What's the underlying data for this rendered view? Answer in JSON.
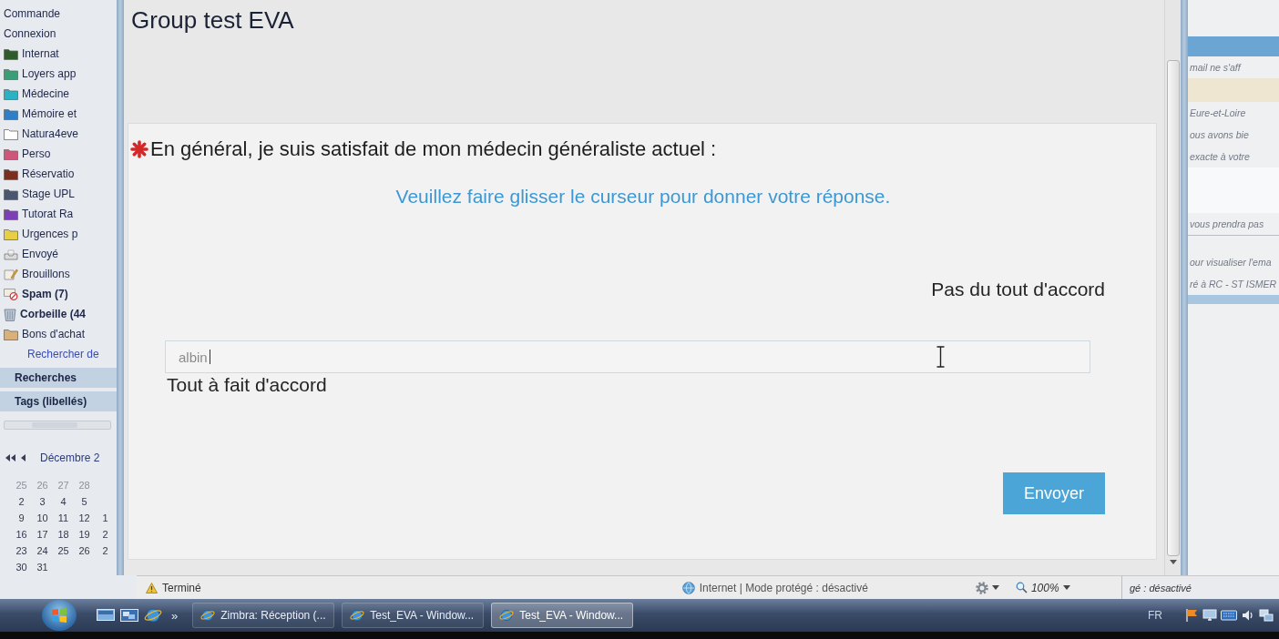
{
  "sidebar": {
    "folders": [
      {
        "label": "Commande",
        "kind": "plain",
        "unread": false
      },
      {
        "label": "Connexion",
        "kind": "plain",
        "unread": false
      },
      {
        "label": "Internat",
        "kind": "folder",
        "color": "#2f5a2a",
        "unread": false
      },
      {
        "label": "Loyers app",
        "kind": "folder",
        "color": "#3a9e78",
        "unread": false
      },
      {
        "label": "Médecine",
        "kind": "folder",
        "color": "#2bb2c2",
        "unread": false
      },
      {
        "label": "Mémoire et",
        "kind": "folder",
        "color": "#2f7fc8",
        "unread": false
      },
      {
        "label": "Natura4eve",
        "kind": "folder",
        "color": "#ffffff",
        "unread": false
      },
      {
        "label": "Perso",
        "kind": "folder",
        "color": "#d0557a",
        "unread": false
      },
      {
        "label": "Réservatio",
        "kind": "folder",
        "color": "#7a2e1e",
        "unread": false
      },
      {
        "label": "Stage UPL",
        "kind": "folder",
        "color": "#4a5570",
        "unread": false
      },
      {
        "label": "Tutorat Ra",
        "kind": "folder",
        "color": "#7d3fb5",
        "unread": false
      },
      {
        "label": "Urgences p",
        "kind": "folder",
        "color": "#e6cf45",
        "unread": false
      },
      {
        "label": "Envoyé",
        "kind": "sent",
        "unread": false
      },
      {
        "label": "Brouillons",
        "kind": "drafts",
        "unread": false
      },
      {
        "label": "Spam (7)",
        "kind": "spam",
        "unread": true
      },
      {
        "label": "Corbeille (44",
        "kind": "trash",
        "unread": true
      },
      {
        "label": "Bons d'achat",
        "kind": "folder",
        "color": "#d9b07a",
        "unread": false
      }
    ],
    "link": "Rechercher de",
    "sections": [
      "Recherches",
      "Tags (libellés)"
    ],
    "calendar": {
      "month": "Décembre 2",
      "weeks": [
        [
          {
            "day": "25",
            "muted": true
          },
          {
            "day": "26",
            "muted": true
          },
          {
            "day": "27",
            "muted": true
          },
          {
            "day": "28",
            "muted": true
          }
        ],
        [
          {
            "day": "2",
            "muted": false
          },
          {
            "day": "3",
            "muted": false
          },
          {
            "day": "4",
            "muted": false
          },
          {
            "day": "5",
            "muted": false
          }
        ],
        [
          {
            "day": "9",
            "muted": false
          },
          {
            "day": "10",
            "muted": false
          },
          {
            "day": "11",
            "muted": false
          },
          {
            "day": "12",
            "muted": false
          },
          {
            "day": "1",
            "muted": false
          }
        ],
        [
          {
            "day": "16",
            "muted": false
          },
          {
            "day": "17",
            "muted": false
          },
          {
            "day": "18",
            "muted": false
          },
          {
            "day": "19",
            "muted": false
          },
          {
            "day": "2",
            "muted": false
          }
        ],
        [
          {
            "day": "23",
            "muted": false
          },
          {
            "day": "24",
            "muted": false
          },
          {
            "day": "25",
            "muted": false
          },
          {
            "day": "26",
            "muted": false
          },
          {
            "day": "2",
            "muted": false
          }
        ],
        [
          {
            "day": "30",
            "muted": false
          },
          {
            "day": "31",
            "muted": false
          }
        ]
      ]
    }
  },
  "page": {
    "title": "Group test EVA",
    "question": {
      "required": true,
      "text": "En général, je suis satisfait de mon médecin généraliste actuel :"
    },
    "instruction": "Veuillez faire glisser le curseur pour donner votre réponse.",
    "scale": {
      "top_label": "Pas du tout d'accord",
      "bottom_label": "Tout à fait d'accord"
    },
    "answer": {
      "value": "albin"
    },
    "submit": "Envoyer"
  },
  "status_bar": {
    "progress_text": "Terminé",
    "zone": "Internet | Mode protégé : désactivé",
    "zoom": "100%"
  },
  "background_window": {
    "lines": [
      "mail ne s'aff",
      "Eure-et-Loire",
      "ous avons bie",
      "exacte à votre",
      "vous prendra pas",
      "our visualiser l'ema",
      "ré à RC - ST ISMER"
    ],
    "status": "gé : désactivé"
  },
  "taskbar": {
    "more": "»",
    "tasks": [
      {
        "label": "Zimbra: Réception (...",
        "selected": false
      },
      {
        "label": "Test_EVA - Window...",
        "selected": false
      },
      {
        "label": "Test_EVA - Window...",
        "selected": true
      }
    ],
    "language": "FR"
  }
}
